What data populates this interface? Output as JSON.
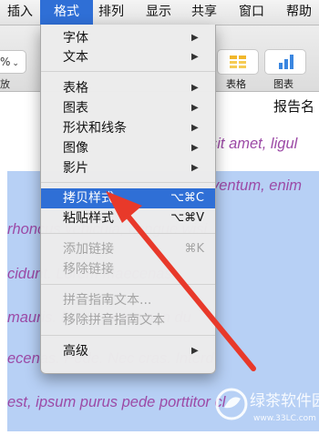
{
  "menubar": {
    "items": [
      "插入",
      "格式",
      "排列",
      "显示",
      "共享",
      "窗口",
      "帮助"
    ]
  },
  "toolbar": {
    "zoom_value": "%",
    "zoom_label": "放",
    "table_label": "表格",
    "chart_label": "图表"
  },
  "document": {
    "title": "报告名",
    "lines": [
      "sit amet, ligul",
      "ventum, enim",
      "rhoncus vehicula, congue wisi",
      "cidunt. Lorem maecenas",
      "mauris. Purus netus non du",
      "ecenas. Pede. Nec cras. Interd",
      "est, ipsum purus pede porttitor cl"
    ]
  },
  "format_menu": {
    "items": [
      {
        "label": "字体",
        "submenu": true
      },
      {
        "label": "文本",
        "submenu": true
      },
      {
        "label": "表格",
        "submenu": true
      },
      {
        "label": "图表",
        "submenu": true
      },
      {
        "label": "形状和线条",
        "submenu": true
      },
      {
        "label": "图像",
        "submenu": true
      },
      {
        "label": "影片",
        "submenu": true
      },
      {
        "label": "拷贝样式",
        "shortcut": "⌥⌘C",
        "highlighted": true
      },
      {
        "label": "粘贴样式",
        "shortcut": "⌥⌘V"
      },
      {
        "label": "添加链接",
        "shortcut": "⌘K",
        "disabled": true
      },
      {
        "label": "移除链接",
        "disabled": true
      },
      {
        "label": "拼音指南文本...",
        "disabled": true
      },
      {
        "label": "移除拼音指南文本",
        "disabled": true
      },
      {
        "label": "高级",
        "submenu": true
      }
    ]
  },
  "watermark": {
    "text": "绿茶软件园",
    "url": "www.33LC.com"
  },
  "colors": {
    "menu_highlight": "#2f6fd6",
    "selection": "#b7d0f5",
    "doc_text": "#9c4aa6",
    "annotation_arrow": "#e8392a"
  }
}
